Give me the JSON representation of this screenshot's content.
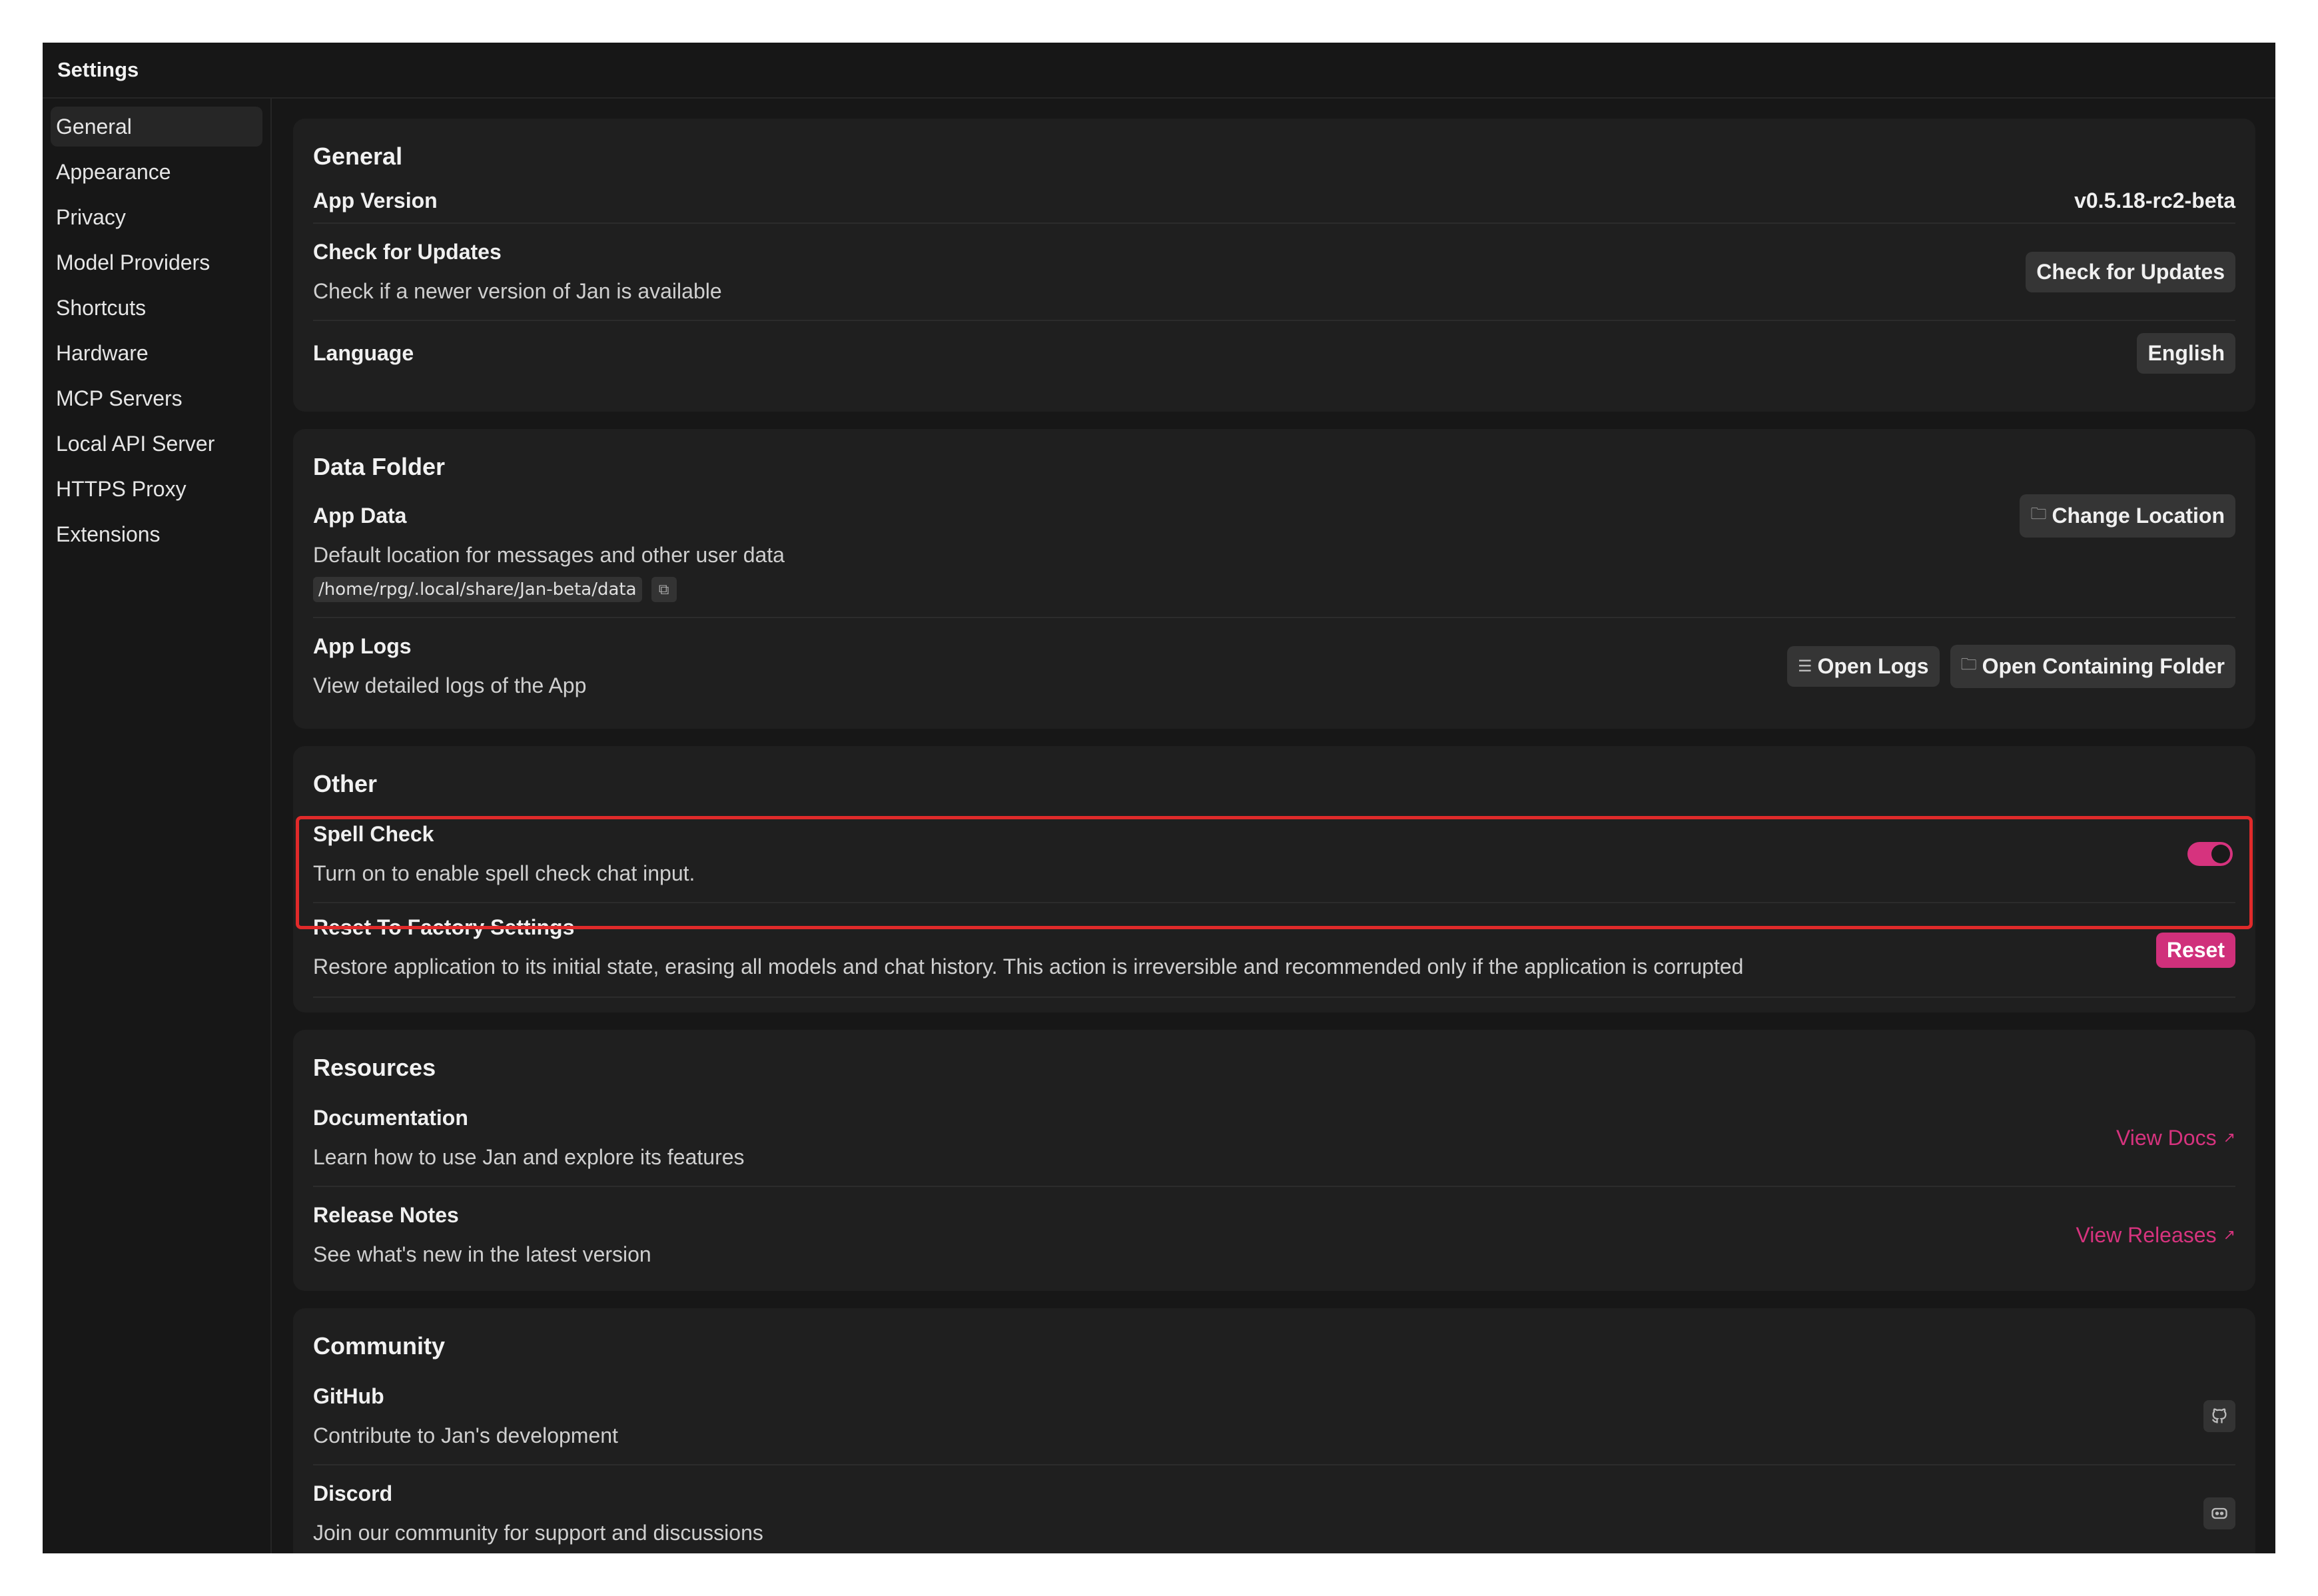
{
  "window": {
    "title": "Settings"
  },
  "sidebar": {
    "items": [
      {
        "label": "General"
      },
      {
        "label": "Appearance"
      },
      {
        "label": "Privacy"
      },
      {
        "label": "Model Providers"
      },
      {
        "label": "Shortcuts"
      },
      {
        "label": "Hardware"
      },
      {
        "label": "MCP Servers"
      },
      {
        "label": "Local API Server"
      },
      {
        "label": "HTTPS Proxy"
      },
      {
        "label": "Extensions"
      }
    ],
    "active": "General"
  },
  "general": {
    "title": "General",
    "app_version_label": "App Version",
    "app_version_value": "v0.5.18-rc2-beta",
    "updates_label": "Check for Updates",
    "updates_desc": "Check if a newer version of Jan is available",
    "updates_button": "Check for Updates",
    "language_label": "Language",
    "language_value": "English"
  },
  "data_folder": {
    "title": "Data Folder",
    "app_data_label": "App Data",
    "app_data_desc": "Default location for messages and other user data",
    "app_data_path": "/home/rpg/.local/share/Jan-beta/data",
    "change_location_button": "Change Location",
    "app_logs_label": "App Logs",
    "app_logs_desc": "View detailed logs of the App",
    "open_logs_button": "Open Logs",
    "open_folder_button": "Open Containing Folder"
  },
  "other": {
    "title": "Other",
    "spell_check_label": "Spell Check",
    "spell_check_desc": "Turn on to enable spell check chat input.",
    "spell_check_enabled": true,
    "reset_label": "Reset To Factory Settings",
    "reset_desc": "Restore application to its initial state, erasing all models and chat history. This action is irreversible and recommended only if the application is corrupted",
    "reset_button": "Reset"
  },
  "resources": {
    "title": "Resources",
    "docs_label": "Documentation",
    "docs_desc": "Learn how to use Jan and explore its features",
    "docs_link": "View Docs",
    "release_label": "Release Notes",
    "release_desc": "See what's new in the latest version",
    "release_link": "View Releases"
  },
  "community": {
    "title": "Community",
    "github_label": "GitHub",
    "github_desc": "Contribute to Jan's development",
    "discord_label": "Discord",
    "discord_desc": "Join our community for support and discussions"
  },
  "colors": {
    "accent": "#d6337e",
    "highlight": "#e02a2a",
    "background": "#171717",
    "card": "#1f1f1f"
  }
}
